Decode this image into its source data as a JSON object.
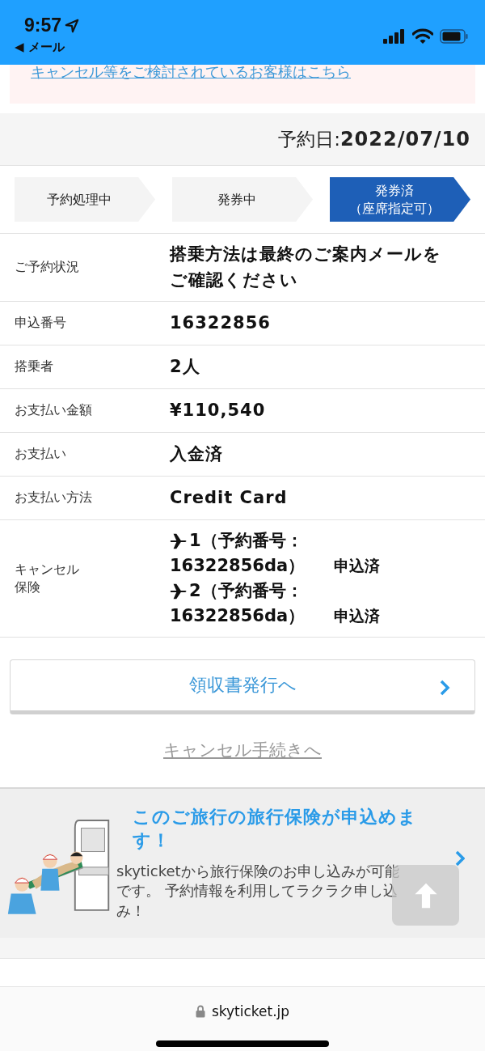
{
  "status_bar": {
    "time": "9:57",
    "back_label": "◀ メール"
  },
  "notice": {
    "link": "キャンセル等をご検討されているお客様はこちら"
  },
  "booking_date": {
    "label": "予約日:",
    "value": "2022/07/10"
  },
  "steps": [
    {
      "label": "予約処理中",
      "selected": false
    },
    {
      "label": "発券中",
      "selected": false
    },
    {
      "label": "発券済",
      "note": "（座席指定可）",
      "selected": true
    }
  ],
  "details": [
    {
      "kind": "text",
      "label": "ご予約状況",
      "value": "搭乗方法は最終のご案内メールをご確認ください"
    },
    {
      "kind": "text",
      "label": "申込番号",
      "value": "16322856"
    },
    {
      "kind": "text",
      "label": "搭乗者",
      "value": "2人"
    },
    {
      "kind": "text",
      "label": "お支払い金額",
      "value": "¥110,540"
    },
    {
      "kind": "text",
      "label": "お支払い",
      "value": "入金済"
    },
    {
      "kind": "text",
      "label": "お支払い方法",
      "value": "Credit Card"
    },
    {
      "kind": "flights",
      "label": "キャンセル保険",
      "flights": [
        {
          "number": "1（予約番号：",
          "reservation": "16322856da）",
          "status": "申込済"
        },
        {
          "number": "2（予約番号：",
          "reservation": "16322856da）",
          "status": "申込済"
        }
      ]
    }
  ],
  "receipt_button": "領収書発行へ",
  "cancel_link": "キャンセル手続きへ",
  "insurance_banner": {
    "title": "このご旅行の旅行保険が申込めます！",
    "body": "skyticketから旅行保険のお申し込みが可能です。 予約情報を利用してラクラク申し込み！"
  },
  "browser_bar": {
    "url": "skyticket.jp"
  }
}
